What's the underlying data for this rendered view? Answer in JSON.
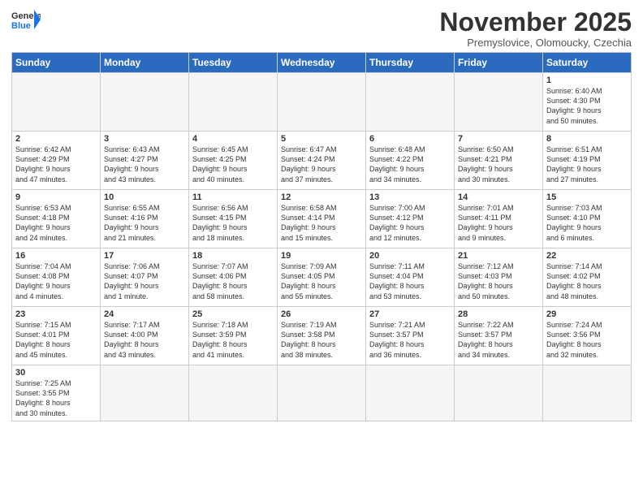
{
  "logo": {
    "text_general": "General",
    "text_blue": "Blue"
  },
  "header": {
    "month_title": "November 2025",
    "subtitle": "Premyslovice, Olomoucky, Czechia"
  },
  "weekdays": [
    "Sunday",
    "Monday",
    "Tuesday",
    "Wednesday",
    "Thursday",
    "Friday",
    "Saturday"
  ],
  "weeks": [
    [
      {
        "day": "",
        "info": ""
      },
      {
        "day": "",
        "info": ""
      },
      {
        "day": "",
        "info": ""
      },
      {
        "day": "",
        "info": ""
      },
      {
        "day": "",
        "info": ""
      },
      {
        "day": "",
        "info": ""
      },
      {
        "day": "1",
        "info": "Sunrise: 6:40 AM\nSunset: 4:30 PM\nDaylight: 9 hours\nand 50 minutes."
      }
    ],
    [
      {
        "day": "2",
        "info": "Sunrise: 6:42 AM\nSunset: 4:29 PM\nDaylight: 9 hours\nand 47 minutes."
      },
      {
        "day": "3",
        "info": "Sunrise: 6:43 AM\nSunset: 4:27 PM\nDaylight: 9 hours\nand 43 minutes."
      },
      {
        "day": "4",
        "info": "Sunrise: 6:45 AM\nSunset: 4:25 PM\nDaylight: 9 hours\nand 40 minutes."
      },
      {
        "day": "5",
        "info": "Sunrise: 6:47 AM\nSunset: 4:24 PM\nDaylight: 9 hours\nand 37 minutes."
      },
      {
        "day": "6",
        "info": "Sunrise: 6:48 AM\nSunset: 4:22 PM\nDaylight: 9 hours\nand 34 minutes."
      },
      {
        "day": "7",
        "info": "Sunrise: 6:50 AM\nSunset: 4:21 PM\nDaylight: 9 hours\nand 30 minutes."
      },
      {
        "day": "8",
        "info": "Sunrise: 6:51 AM\nSunset: 4:19 PM\nDaylight: 9 hours\nand 27 minutes."
      }
    ],
    [
      {
        "day": "9",
        "info": "Sunrise: 6:53 AM\nSunset: 4:18 PM\nDaylight: 9 hours\nand 24 minutes."
      },
      {
        "day": "10",
        "info": "Sunrise: 6:55 AM\nSunset: 4:16 PM\nDaylight: 9 hours\nand 21 minutes."
      },
      {
        "day": "11",
        "info": "Sunrise: 6:56 AM\nSunset: 4:15 PM\nDaylight: 9 hours\nand 18 minutes."
      },
      {
        "day": "12",
        "info": "Sunrise: 6:58 AM\nSunset: 4:14 PM\nDaylight: 9 hours\nand 15 minutes."
      },
      {
        "day": "13",
        "info": "Sunrise: 7:00 AM\nSunset: 4:12 PM\nDaylight: 9 hours\nand 12 minutes."
      },
      {
        "day": "14",
        "info": "Sunrise: 7:01 AM\nSunset: 4:11 PM\nDaylight: 9 hours\nand 9 minutes."
      },
      {
        "day": "15",
        "info": "Sunrise: 7:03 AM\nSunset: 4:10 PM\nDaylight: 9 hours\nand 6 minutes."
      }
    ],
    [
      {
        "day": "16",
        "info": "Sunrise: 7:04 AM\nSunset: 4:08 PM\nDaylight: 9 hours\nand 4 minutes."
      },
      {
        "day": "17",
        "info": "Sunrise: 7:06 AM\nSunset: 4:07 PM\nDaylight: 9 hours\nand 1 minute."
      },
      {
        "day": "18",
        "info": "Sunrise: 7:07 AM\nSunset: 4:06 PM\nDaylight: 8 hours\nand 58 minutes."
      },
      {
        "day": "19",
        "info": "Sunrise: 7:09 AM\nSunset: 4:05 PM\nDaylight: 8 hours\nand 55 minutes."
      },
      {
        "day": "20",
        "info": "Sunrise: 7:11 AM\nSunset: 4:04 PM\nDaylight: 8 hours\nand 53 minutes."
      },
      {
        "day": "21",
        "info": "Sunrise: 7:12 AM\nSunset: 4:03 PM\nDaylight: 8 hours\nand 50 minutes."
      },
      {
        "day": "22",
        "info": "Sunrise: 7:14 AM\nSunset: 4:02 PM\nDaylight: 8 hours\nand 48 minutes."
      }
    ],
    [
      {
        "day": "23",
        "info": "Sunrise: 7:15 AM\nSunset: 4:01 PM\nDaylight: 8 hours\nand 45 minutes."
      },
      {
        "day": "24",
        "info": "Sunrise: 7:17 AM\nSunset: 4:00 PM\nDaylight: 8 hours\nand 43 minutes."
      },
      {
        "day": "25",
        "info": "Sunrise: 7:18 AM\nSunset: 3:59 PM\nDaylight: 8 hours\nand 41 minutes."
      },
      {
        "day": "26",
        "info": "Sunrise: 7:19 AM\nSunset: 3:58 PM\nDaylight: 8 hours\nand 38 minutes."
      },
      {
        "day": "27",
        "info": "Sunrise: 7:21 AM\nSunset: 3:57 PM\nDaylight: 8 hours\nand 36 minutes."
      },
      {
        "day": "28",
        "info": "Sunrise: 7:22 AM\nSunset: 3:57 PM\nDaylight: 8 hours\nand 34 minutes."
      },
      {
        "day": "29",
        "info": "Sunrise: 7:24 AM\nSunset: 3:56 PM\nDaylight: 8 hours\nand 32 minutes."
      }
    ],
    [
      {
        "day": "30",
        "info": "Sunrise: 7:25 AM\nSunset: 3:55 PM\nDaylight: 8 hours\nand 30 minutes."
      },
      {
        "day": "",
        "info": ""
      },
      {
        "day": "",
        "info": ""
      },
      {
        "day": "",
        "info": ""
      },
      {
        "day": "",
        "info": ""
      },
      {
        "day": "",
        "info": ""
      },
      {
        "day": "",
        "info": ""
      }
    ]
  ]
}
